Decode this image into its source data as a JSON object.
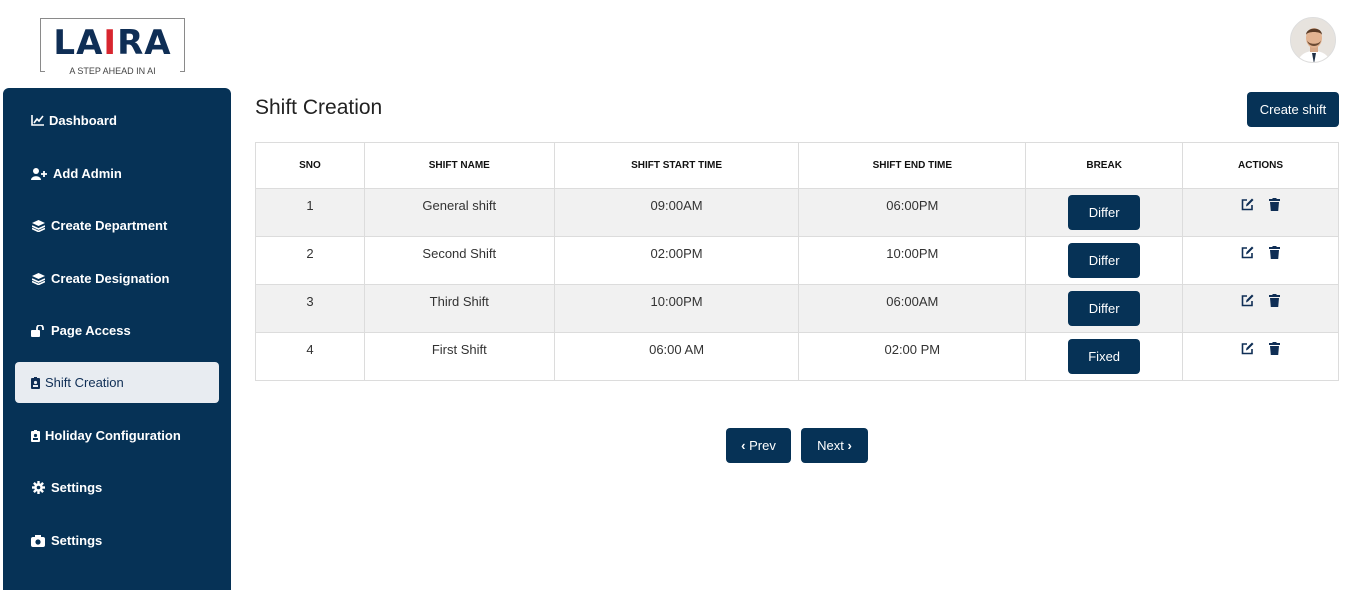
{
  "brand": {
    "logo_prefix": "LA",
    "logo_accent": "I",
    "logo_suffix": "RA",
    "tagline": "A STEP AHEAD IN AI"
  },
  "colors": {
    "sidebar": "#063256",
    "button": "#063256",
    "logo_red": "#d8262f"
  },
  "sidebar": {
    "items": [
      {
        "label": "Dashboard",
        "icon": "chart-line-icon"
      },
      {
        "label": "Add Admin",
        "icon": "user-plus-icon"
      },
      {
        "label": "Create Department",
        "icon": "layers-icon"
      },
      {
        "label": "Create Designation",
        "icon": "layers-icon"
      },
      {
        "label": "Page Access",
        "icon": "unlock-icon"
      },
      {
        "label": "Shift Creation",
        "icon": "id-badge-icon",
        "active": true
      },
      {
        "label": "Holiday Configuration",
        "icon": "id-badge-icon"
      },
      {
        "label": "Settings",
        "icon": "gear-icon"
      },
      {
        "label": "Settings",
        "icon": "camera-icon"
      }
    ]
  },
  "main": {
    "title": "Shift Creation",
    "create_button": "Create shift",
    "columns": [
      "SNO",
      "SHIFT NAME",
      "SHIFT START TIME",
      "SHIFT END TIME",
      "BREAK",
      "ACTIONS"
    ],
    "rows": [
      {
        "sno": "1",
        "name": "General shift",
        "start": "09:00AM",
        "end": "06:00PM",
        "break": "Differ"
      },
      {
        "sno": "2",
        "name": "Second Shift",
        "start": "02:00PM",
        "end": "10:00PM",
        "break": "Differ"
      },
      {
        "sno": "3",
        "name": "Third Shift",
        "start": "10:00PM",
        "end": "06:00AM",
        "break": "Differ"
      },
      {
        "sno": "4",
        "name": "First Shift",
        "start": "06:00 AM",
        "end": "02:00 PM",
        "break": "Fixed"
      }
    ],
    "pagination": {
      "prev": "Prev",
      "next": "Next"
    }
  }
}
